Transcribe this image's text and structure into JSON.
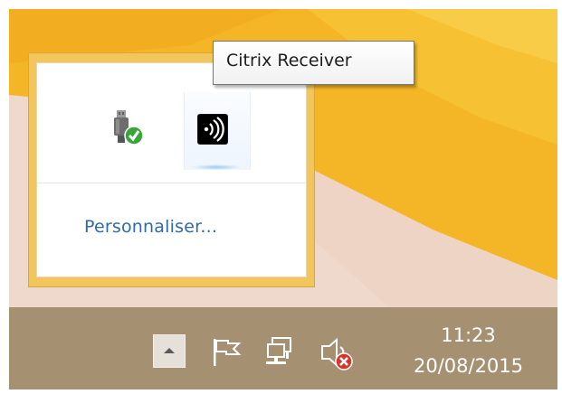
{
  "tooltip": {
    "text": "Citrix Receiver"
  },
  "flyout": {
    "icons": [
      "usb-safely-remove-icon",
      "citrix-receiver-icon"
    ],
    "customize_label": "Personnaliser..."
  },
  "taskbar": {
    "show_hidden_icon": "chevron-up-icon",
    "icons": [
      "action-center-flag-icon",
      "network-icon",
      "volume-muted-icon"
    ],
    "time": "11:23",
    "date": "20/08/2015"
  },
  "colors": {
    "taskbar": "#a69072",
    "flyout_border": "#f2c65c",
    "link": "#2f6aa8",
    "wallpaper_yellow": "#f4b526"
  }
}
